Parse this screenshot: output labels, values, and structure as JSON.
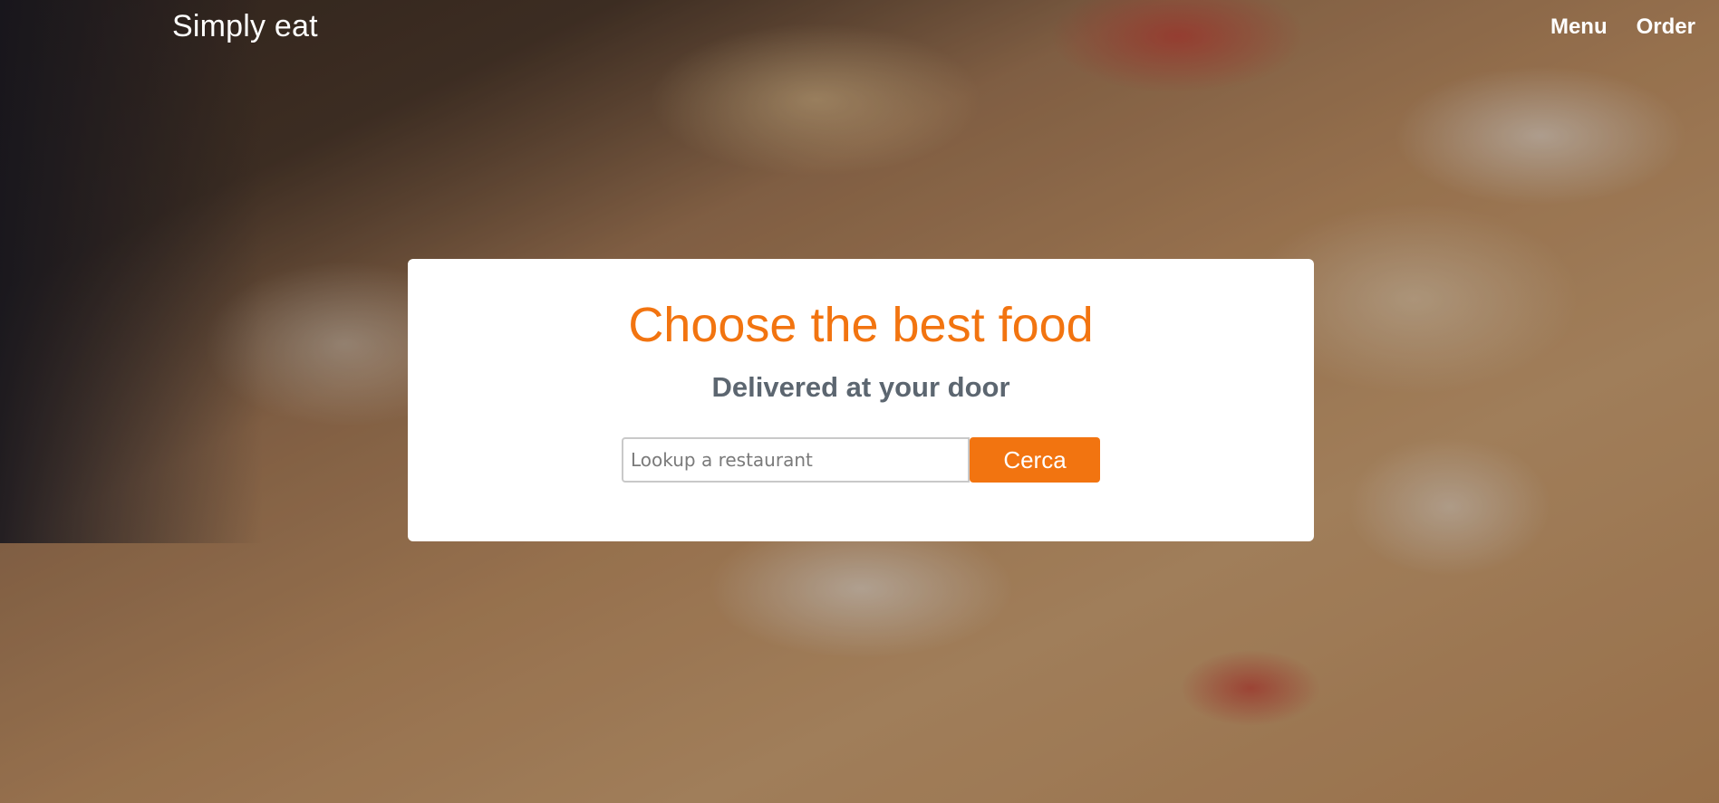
{
  "header": {
    "brand": "Simply eat",
    "nav": [
      {
        "label": "Menu"
      },
      {
        "label": "Order"
      }
    ]
  },
  "hero": {
    "title": "Choose the best food",
    "subtitle": "Delivered at your door",
    "search": {
      "placeholder": "Lookup a restaurant",
      "value": "",
      "button_label": "Cerca"
    }
  },
  "colors": {
    "accent": "#f27410",
    "subtitle": "#5c6670"
  }
}
